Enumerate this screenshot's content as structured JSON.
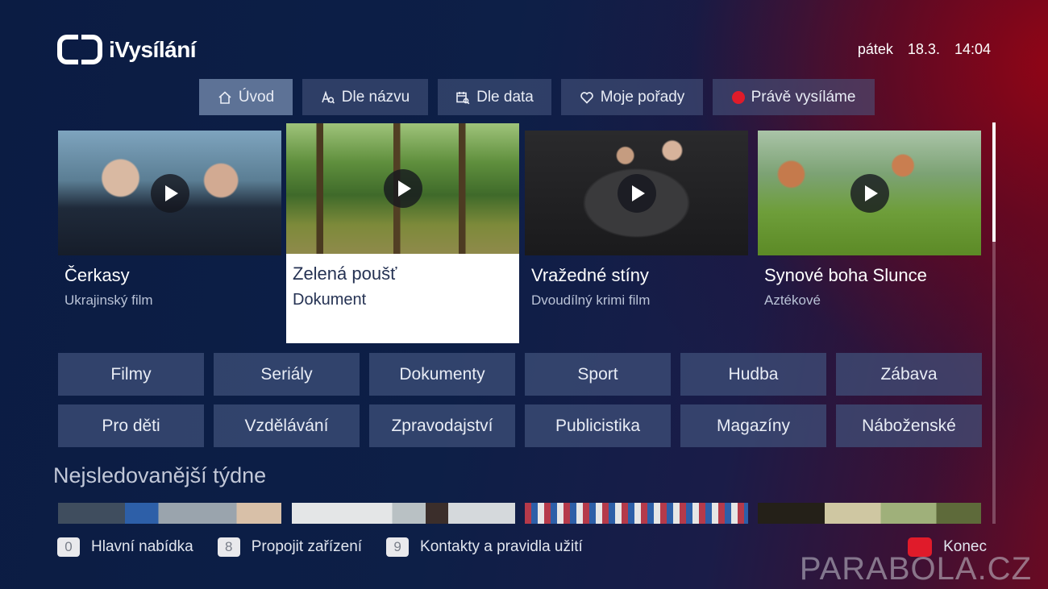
{
  "header": {
    "logo_text": "iVysílání",
    "day": "pátek",
    "date": "18.3.",
    "time": "14:04"
  },
  "nav": [
    {
      "label": "Úvod",
      "icon": "home-icon",
      "active": true
    },
    {
      "label": "Dle názvu",
      "icon": "search-letter-icon",
      "active": false
    },
    {
      "label": "Dle data",
      "icon": "calendar-icon",
      "active": false
    },
    {
      "label": "Moje pořady",
      "icon": "heart-icon",
      "active": false
    },
    {
      "label": "Právě vysíláme",
      "icon": "live-dot-icon",
      "active": false
    }
  ],
  "featured": [
    {
      "title": "Čerkasy",
      "subtitle": "Ukrajinský film"
    },
    {
      "title": "Zelená poušť",
      "subtitle": "Dokument"
    },
    {
      "title": "Vražedné stíny",
      "subtitle": "Dvoudílný krimi film"
    },
    {
      "title": "Synové boha Slunce",
      "subtitle": "Aztékové"
    }
  ],
  "categories": [
    "Filmy",
    "Seriály",
    "Dokumenty",
    "Sport",
    "Hudba",
    "Zábava",
    "Pro děti",
    "Vzdělávání",
    "Zpravodajství",
    "Publicistika",
    "Magazíny",
    "Náboženské"
  ],
  "section_title": "Nejsledovanější týdne",
  "footer": [
    {
      "key": "0",
      "label": "Hlavní nabídka"
    },
    {
      "key": "8",
      "label": "Propojit zařízení"
    },
    {
      "key": "9",
      "label": "Kontakty a pravidla užití"
    }
  ],
  "exit_label": "Konec",
  "watermark": "PARABOLA.CZ",
  "colors": {
    "live": "#e01b2a",
    "exit_key": "#e01b2a",
    "nav_active": "#5d7296"
  }
}
